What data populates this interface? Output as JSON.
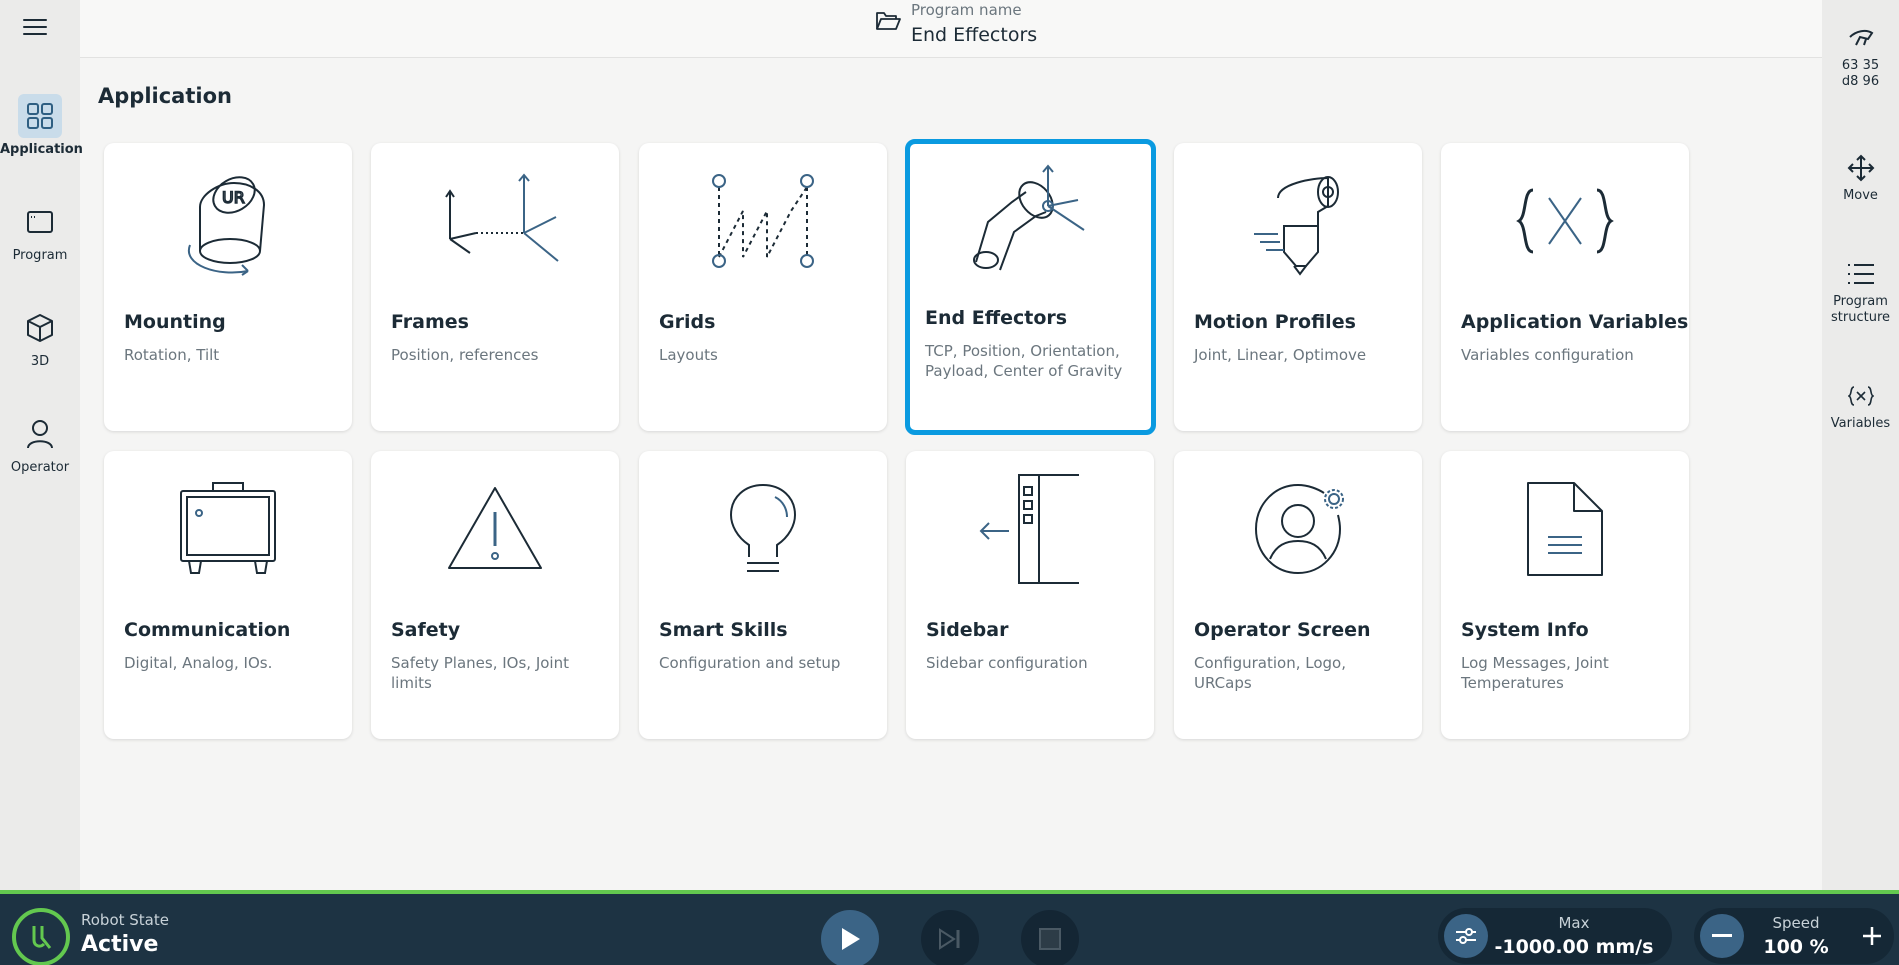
{
  "header": {
    "program_label": "Program name",
    "program_name": "End Effectors"
  },
  "page_title": "Application",
  "left_nav": [
    {
      "label": "Application",
      "icon": "grid-icon",
      "active": true
    },
    {
      "label": "Program",
      "icon": "window-icon",
      "active": false
    },
    {
      "label": "3D",
      "icon": "cube-icon",
      "active": false
    },
    {
      "label": "Operator",
      "icon": "person-icon",
      "active": false
    }
  ],
  "right_nav": {
    "serial_line1": "63 35",
    "serial_line2": "d8 96",
    "move_label": "Move",
    "structure_label": "Program structure",
    "variables_label": "Variables"
  },
  "cards": [
    {
      "title": "Mounting",
      "subtitle": "Rotation, Tilt",
      "icon": "mounting-icon"
    },
    {
      "title": "Frames",
      "subtitle": "Position, references",
      "icon": "frames-icon"
    },
    {
      "title": "Grids",
      "subtitle": "Layouts",
      "icon": "grids-icon"
    },
    {
      "title": "End Effectors",
      "subtitle": "TCP, Position, Orientation, Payload, Center of Gravity",
      "icon": "end-effector-icon",
      "selected": true
    },
    {
      "title": "Motion Profiles",
      "subtitle": "Joint, Linear, Optimove",
      "icon": "motion-profile-icon"
    },
    {
      "title": "Application Variables",
      "subtitle": "Variables configuration",
      "icon": "variable-x-icon"
    },
    {
      "title": "Communication",
      "subtitle": "Digital, Analog, IOs.",
      "icon": "control-box-icon"
    },
    {
      "title": "Safety",
      "subtitle": "Safety Planes, IOs, Joint limits",
      "icon": "warning-icon"
    },
    {
      "title": "Smart Skills",
      "subtitle": "Configuration and setup",
      "icon": "lightbulb-icon"
    },
    {
      "title": "Sidebar",
      "subtitle": "Sidebar configuration",
      "icon": "sidebar-icon"
    },
    {
      "title": "Operator Screen",
      "subtitle": "Configuration, Logo, URCaps",
      "icon": "operator-settings-icon"
    },
    {
      "title": "System Info",
      "subtitle": "Log Messages, Joint Temperatures",
      "icon": "document-icon"
    }
  ],
  "bottom_bar": {
    "state_label": "Robot State",
    "state_value": "Active",
    "max_label": "Max",
    "max_value": "-1000.00 mm/s",
    "speed_label": "Speed",
    "speed_value": "100 %"
  },
  "colors": {
    "accent": "#0a9ae0",
    "bottom_bar": "#1d3343",
    "status_green": "#63c84f",
    "play_button": "#3b6486"
  }
}
